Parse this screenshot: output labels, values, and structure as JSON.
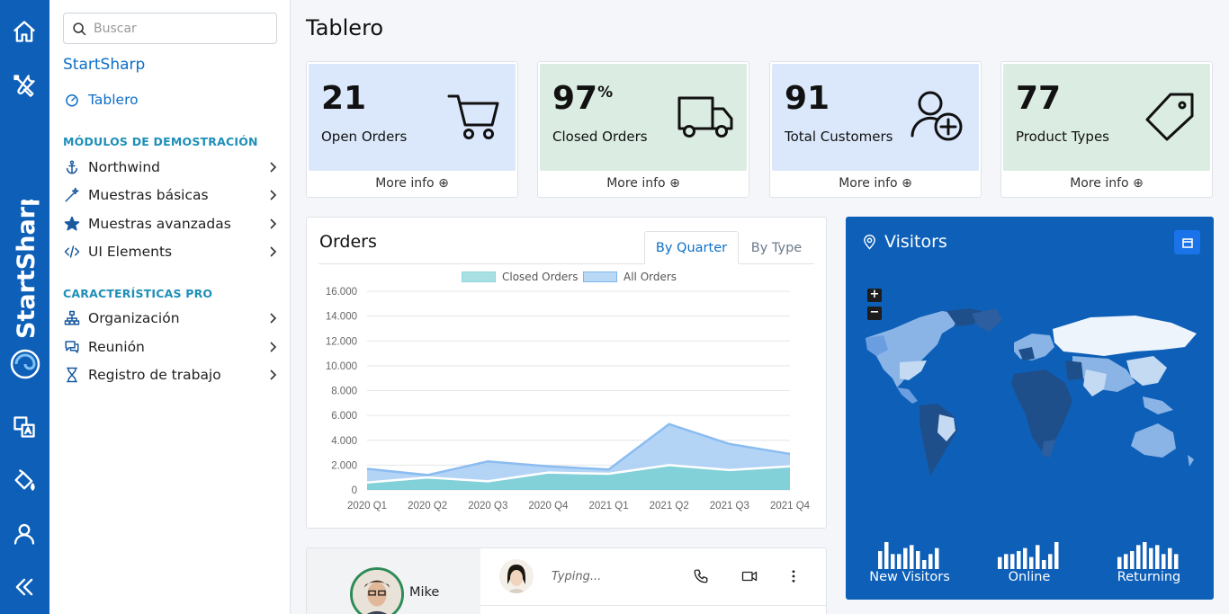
{
  "sidebar": {
    "search_placeholder": "Buscar",
    "app_title": "StartSharp",
    "active_item": "Tablero",
    "section_demo": "MÓDULOS DE DEMOSTRACIÓN",
    "demo_items": [
      "Northwind",
      "Muestras básicas",
      "Muestras avanzadas",
      "UI Elements"
    ],
    "section_pro": "CARACTERÍSTICAS PRO",
    "pro_items": [
      "Organización",
      "Reunión",
      "Registro de trabajo"
    ]
  },
  "rail": {
    "brand": "StartSharp",
    "icons": [
      "home-icon",
      "tools-icon",
      "translate-icon",
      "paint-bucket-icon",
      "user-icon",
      "collapse-icon"
    ]
  },
  "page": {
    "title": "Tablero"
  },
  "stats": [
    {
      "value": "21",
      "suffix": "",
      "label": "Open Orders",
      "more": "More info",
      "icon": "cart-icon",
      "color": "#dbe8fc"
    },
    {
      "value": "97",
      "suffix": "%",
      "label": "Closed Orders",
      "more": "More info",
      "icon": "truck-icon",
      "color": "#dbece2"
    },
    {
      "value": "91",
      "suffix": "",
      "label": "Total Customers",
      "more": "More info",
      "icon": "user-plus-icon",
      "color": "#dbe8fc"
    },
    {
      "value": "77",
      "suffix": "",
      "label": "Product Types",
      "more": "More info",
      "icon": "tag-icon",
      "color": "#dbece2"
    }
  ],
  "orders": {
    "title": "Orders",
    "tabs": [
      "By Quarter",
      "By Type"
    ],
    "active_tab": "By Quarter"
  },
  "chart_data": {
    "type": "area",
    "categories": [
      "2020 Q1",
      "2020 Q2",
      "2020 Q3",
      "2020 Q4",
      "2021 Q1",
      "2021 Q2",
      "2021 Q3",
      "2021 Q4"
    ],
    "series": [
      {
        "name": "Closed Orders",
        "values": [
          600,
          1000,
          700,
          1400,
          1300,
          2000,
          1600,
          1900
        ],
        "color": "#8fd6dc"
      },
      {
        "name": "All Orders",
        "values": [
          1700,
          1200,
          2300,
          1900,
          1650,
          5300,
          3700,
          2900
        ],
        "color": "#a9cff4"
      }
    ],
    "ylim": [
      0,
      16000
    ],
    "yticks": [
      "0",
      "2.000",
      "4.000",
      "6.000",
      "8.000",
      "10.000",
      "12.000",
      "14.000",
      "16.000"
    ],
    "ytick_values": [
      0,
      2000,
      4000,
      6000,
      8000,
      10000,
      12000,
      14000,
      16000
    ],
    "grid": true,
    "legend": "top-center"
  },
  "visitors": {
    "title": "Visitors",
    "zoom_in": "+",
    "zoom_out": "−",
    "stats": [
      {
        "label": "New Visitors",
        "bars": [
          6,
          9,
          5,
          5,
          7,
          8,
          6,
          3,
          5,
          7
        ]
      },
      {
        "label": "Online",
        "bars": [
          4,
          5,
          5,
          6,
          7,
          4,
          8,
          3,
          5,
          9
        ]
      },
      {
        "label": "Returning",
        "bars": [
          4,
          5,
          6,
          8,
          9,
          7,
          8,
          5,
          7,
          5
        ]
      }
    ]
  },
  "chat": {
    "contact": "Mike",
    "typing": "Typing..."
  }
}
